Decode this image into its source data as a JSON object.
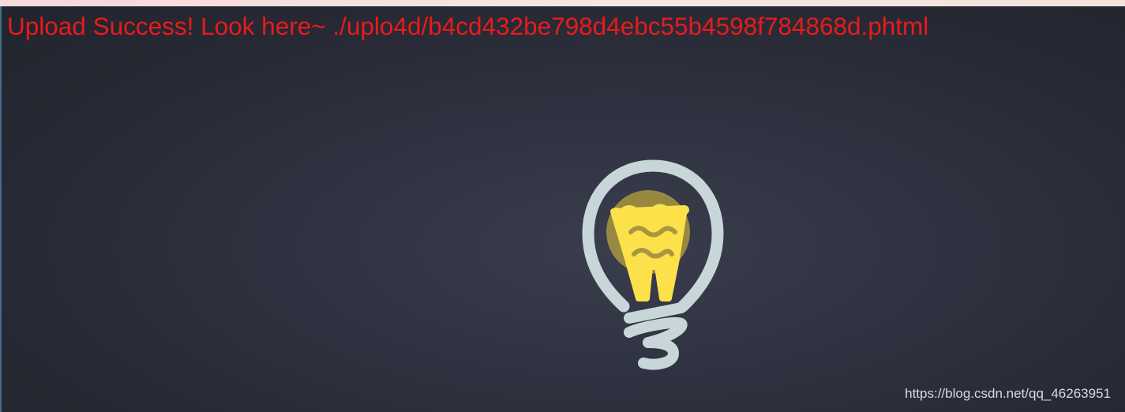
{
  "message": {
    "text": "Upload Success! Look here~ ./uplo4d/b4cd432be798d4ebc55b4598f784868d.phtml",
    "color": "#e81b1b"
  },
  "illustration": {
    "icon": "lightbulb-icon",
    "bulb_outline_color": "#c9d6d9",
    "glow_color": "#a8973f",
    "filament_color": "#fde14a"
  },
  "watermark": {
    "text": "https://blog.csdn.net/qq_46263951"
  },
  "theme": {
    "background": "#2b2e3a",
    "top_strip": "#f5e1de"
  }
}
